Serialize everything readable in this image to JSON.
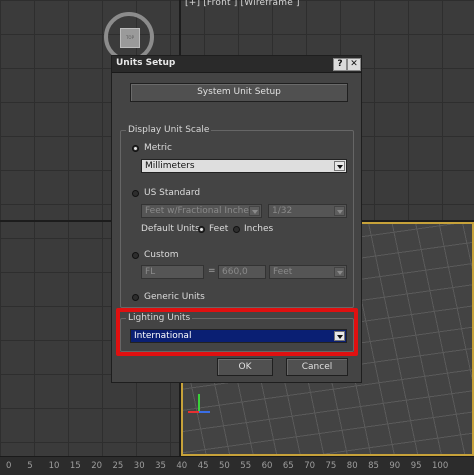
{
  "viewport": {
    "front_label": "[+] [Front ] [Wireframe ]",
    "viewcube_face": "TOP"
  },
  "ruler": {
    "ticks": [
      "0",
      "5",
      "10",
      "15",
      "20",
      "25",
      "30",
      "35",
      "40",
      "45",
      "50",
      "55",
      "60",
      "65",
      "70",
      "75",
      "80",
      "85",
      "90",
      "95",
      "100"
    ]
  },
  "dialog": {
    "title": "Units Setup",
    "help_button": "?",
    "close_button": "✕",
    "system_unit_setup_label": "System Unit Setup",
    "display_unit_scale": {
      "group_label": "Display Unit Scale",
      "metric": {
        "label": "Metric",
        "selected": true,
        "dropdown_value": "Millimeters"
      },
      "us_standard": {
        "label": "US Standard",
        "selected": false,
        "dropdown_value": "Feet w/Fractional Inches",
        "fraction_value": "1/32",
        "default_units_label": "Default Units:",
        "feet_label": "Feet",
        "inches_label": "Inches"
      },
      "custom": {
        "label": "Custom",
        "selected": false,
        "name_value": "FL",
        "equals": "=",
        "amount_value": "660,0",
        "unit_value": "Feet"
      },
      "generic": {
        "label": "Generic Units",
        "selected": false
      }
    },
    "lighting_units": {
      "group_label": "Lighting Units",
      "dropdown_value": "International"
    },
    "ok_label": "OK",
    "cancel_label": "Cancel"
  },
  "colors": {
    "highlight": "#e01010",
    "selection": "#0a1f73"
  }
}
